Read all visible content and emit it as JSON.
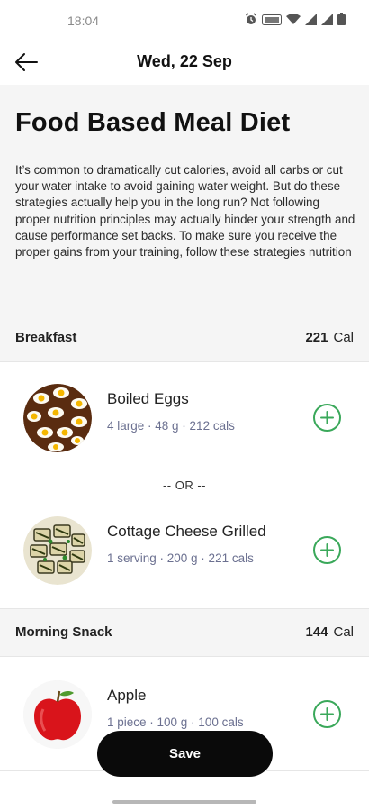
{
  "status_bar": {
    "time": "18:04",
    "icons": [
      "alarm-icon",
      "volte-icon",
      "wifi-icon",
      "signal-icon",
      "signal-icon",
      "battery-icon"
    ]
  },
  "app_bar": {
    "back_icon": "arrow-left-icon",
    "title": "Wed, 22 Sep"
  },
  "intro": {
    "title": "Food Based Meal Diet",
    "description": "It’s common to dramatically cut calories, avoid all carbs or cut your water intake to avoid gaining water weight. But do these strategies actually help you in the long run? Not following proper nutrition principles may actually hinder your strength and cause performance set backs. To make sure you receive the proper gains from your training, follow these strategies nutrition"
  },
  "sections": [
    {
      "name": "Breakfast",
      "calories": "221",
      "unit": "Cal",
      "separator": "-- OR --",
      "items": [
        {
          "name": "Boiled Eggs",
          "meta": "4 large · 48 g · 212 cals",
          "image": "boiled-eggs"
        },
        {
          "name": "Cottage Cheese Grilled",
          "meta": "1 serving · 200 g · 221 cals",
          "image": "cottage-cheese-grilled"
        }
      ]
    },
    {
      "name": "Morning Snack",
      "calories": "144",
      "unit": "Cal",
      "items": [
        {
          "name": "Apple",
          "meta": "1 piece · 100 g · 100 cals",
          "image": "apple"
        }
      ]
    }
  ],
  "save_label": "Save",
  "colors": {
    "accent_green": "#3aa85a",
    "section_bg": "#f5f5f5",
    "meta_text": "#6b7090",
    "save_bg": "#0a0a0a"
  }
}
